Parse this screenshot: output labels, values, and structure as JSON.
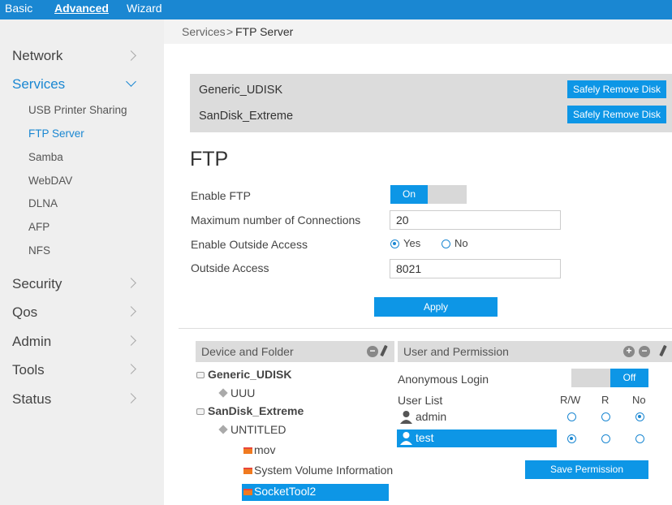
{
  "topnav": {
    "basic": "Basic",
    "advanced": "Advanced",
    "wizard": "Wizard"
  },
  "sidebar": {
    "network": "Network",
    "services": "Services",
    "sub": [
      "USB Printer Sharing",
      "FTP Server",
      "Samba",
      "WebDAV",
      "DLNA",
      "AFP",
      "NFS"
    ],
    "security": "Security",
    "qos": "Qos",
    "admin": "Admin",
    "tools": "Tools",
    "status": "Status"
  },
  "breadcrumb": {
    "parent": "Services",
    "separator": ">",
    "current": "FTP Server"
  },
  "disks": [
    {
      "name": "Generic_UDISK",
      "button": "Safely Remove Disk"
    },
    {
      "name": "SanDisk_Extreme",
      "button": "Safely Remove Disk"
    }
  ],
  "ftp": {
    "title": "FTP",
    "enable_label": "Enable FTP",
    "enable_value": "On",
    "max_conn_label": "Maximum number of Connections",
    "max_conn_value": "20",
    "outside_label": "Enable Outside Access",
    "outside_yes": "Yes",
    "outside_no": "No",
    "outside_selected": "Yes",
    "port_label": "Outside Access",
    "port_value": "8021",
    "apply": "Apply"
  },
  "device_panel": {
    "title": "Device and Folder",
    "tree": {
      "disk1": "Generic_UDISK",
      "disk1_part": "UUU",
      "disk2": "SanDisk_Extreme",
      "disk2_part": "UNTITLED",
      "folders": [
        "mov",
        "System Volume Information",
        "SocketTool2"
      ]
    }
  },
  "user_panel": {
    "title": "User and Permission",
    "anonymous_label": "Anonymous Login",
    "anonymous_value": "Off",
    "user_list_label": "User List",
    "col_rw": "R/W",
    "col_r": "R",
    "col_no": "No",
    "users": [
      {
        "name": "admin",
        "permission": "No"
      },
      {
        "name": "test",
        "permission": "R/W"
      }
    ],
    "save": "Save Permission"
  },
  "colors": {
    "accent": "#1a87d2",
    "button": "#0d96e6",
    "sidebar_bg": "#efefef",
    "panel_gray": "#dcdcdc"
  }
}
